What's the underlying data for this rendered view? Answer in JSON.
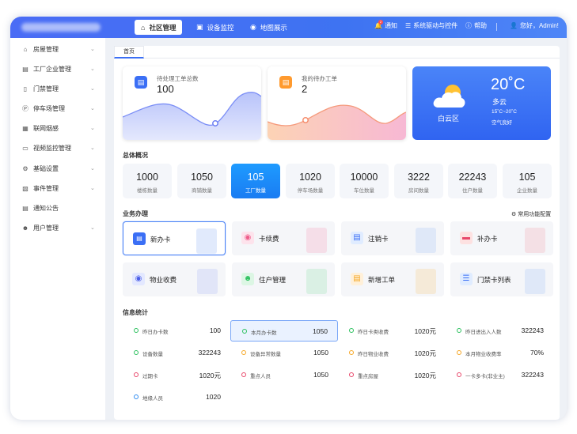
{
  "topbar": {
    "tabs": [
      {
        "label": "社区管理",
        "icon": "home-icon"
      },
      {
        "label": "设备监控",
        "icon": "monitor-icon"
      },
      {
        "label": "地图展示",
        "icon": "map-pin-icon"
      }
    ],
    "notice": {
      "label": "通知",
      "badge": "2"
    },
    "drivers": "系统驱动与控件",
    "help": "帮助",
    "greeting": "您好，Admin!"
  },
  "sidebar": {
    "items": [
      {
        "label": "房屋管理",
        "icon": "house-icon"
      },
      {
        "label": "工厂企业管理",
        "icon": "factory-icon"
      },
      {
        "label": "门禁管理",
        "icon": "door-icon"
      },
      {
        "label": "停车场管理",
        "icon": "parking-icon"
      },
      {
        "label": "联网烟感",
        "icon": "smoke-detector-icon"
      },
      {
        "label": "视频监控管理",
        "icon": "monitor-icon"
      },
      {
        "label": "基础设置",
        "icon": "gear-icon"
      },
      {
        "label": "事件管理",
        "icon": "event-icon"
      },
      {
        "label": "通知公告",
        "icon": "notice-icon"
      },
      {
        "label": "用户管理",
        "icon": "user-icon"
      }
    ]
  },
  "tabbar": {
    "home": "首页"
  },
  "stats": [
    {
      "label": "待处理工单总数",
      "value": "100",
      "accent": "#3b6ff5"
    },
    {
      "label": "我的待办工单",
      "value": "2",
      "accent": "#ff9a2e"
    }
  ],
  "weather": {
    "temp": "20˚C",
    "condition": "多云",
    "range": "15˚C~20˚C",
    "air": "空气良好",
    "location": "白云区"
  },
  "overview": {
    "title": "总体概况",
    "items": [
      {
        "num": "1000",
        "label": "楼栋数量"
      },
      {
        "num": "1050",
        "label": "商铺数量"
      },
      {
        "num": "105",
        "label": "工厂数量"
      },
      {
        "num": "1020",
        "label": "停车场数量"
      },
      {
        "num": "10000",
        "label": "车位数量"
      },
      {
        "num": "3222",
        "label": "房间数量"
      },
      {
        "num": "22243",
        "label": "住户数量"
      },
      {
        "num": "105",
        "label": "企业数量"
      }
    ]
  },
  "business": {
    "title": "业务办理",
    "settings": "常用功能配置",
    "items": [
      {
        "label": "新办卡",
        "icon": "id-card-icon"
      },
      {
        "label": "卡续费",
        "icon": "money-bag-icon"
      },
      {
        "label": "注销卡",
        "icon": "card-cancel-icon"
      },
      {
        "label": "补办卡",
        "icon": "credit-card-icon"
      },
      {
        "label": "物业收费",
        "icon": "property-fee-icon"
      },
      {
        "label": "住户管理",
        "icon": "resident-icon"
      },
      {
        "label": "新增工单",
        "icon": "add-order-icon"
      },
      {
        "label": "门禁卡列表",
        "icon": "list-icon"
      }
    ]
  },
  "info": {
    "title": "信息统计",
    "items": [
      {
        "label": "昨日办卡数",
        "value": "100",
        "color": "#2ac05d"
      },
      {
        "label": "本月办卡数",
        "value": "1050",
        "color": "#2ac05d"
      },
      {
        "label": "昨日卡类收费",
        "value": "1020元",
        "color": "#2ac05d"
      },
      {
        "label": "昨日进出入人数",
        "value": "322243",
        "color": "#2ac05d"
      },
      {
        "label": "设备数量",
        "value": "322243",
        "color": "#2ac05d"
      },
      {
        "label": "设备异常数量",
        "value": "1050",
        "color": "#f5a623"
      },
      {
        "label": "昨日物业收费",
        "value": "1020元",
        "color": "#f5a623"
      },
      {
        "label": "本月物业收费率",
        "value": "70%",
        "color": "#f5a623"
      },
      {
        "label": "过期卡",
        "value": "1020元",
        "color": "#e8476a"
      },
      {
        "label": "重点人员",
        "value": "1050",
        "color": "#e8476a"
      },
      {
        "label": "重点房屋",
        "value": "1020元",
        "color": "#e8476a"
      },
      {
        "label": "一卡多卡(非业主)",
        "value": "322243",
        "color": "#e8476a"
      },
      {
        "label": "地缘人员",
        "value": "1020",
        "color": "#2f8cf0"
      }
    ]
  }
}
